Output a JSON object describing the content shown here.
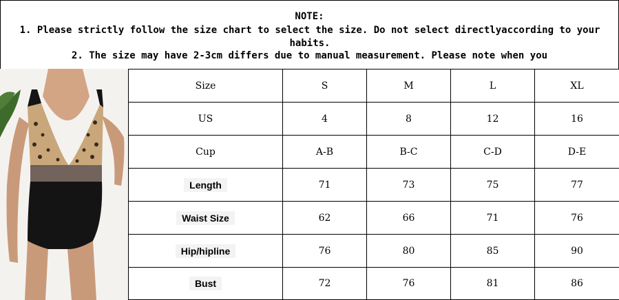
{
  "note": {
    "title": "NOTE:",
    "line1": "1. Please strictly follow the size chart to select the size. Do not select directlyaccording to your habits.",
    "line2": "2. The size may have 2-3cm differs due to manual measurement. Please note when you"
  },
  "table": {
    "header": {
      "label": "Size",
      "values": [
        "S",
        "M",
        "L",
        "XL"
      ]
    },
    "rows": [
      {
        "label": "US",
        "values": [
          "4",
          "8",
          "12",
          "16"
        ]
      },
      {
        "label": "Cup",
        "values": [
          "A-B",
          "B-C",
          "C-D",
          "D-E"
        ]
      },
      {
        "label": "Length",
        "values": [
          "71",
          "73",
          "75",
          "77"
        ]
      },
      {
        "label": "Waist Size",
        "values": [
          "62",
          "66",
          "71",
          "76"
        ]
      },
      {
        "label": "Hip/hipline",
        "values": [
          "76",
          "80",
          "85",
          "90"
        ]
      },
      {
        "label": "Bust",
        "values": [
          "72",
          "76",
          "81",
          "86"
        ]
      }
    ]
  },
  "colors": {
    "leopard_base": "#c9a77a",
    "leopard_spot": "#3a2a1c",
    "swimsuit": "#141414",
    "skin": "#c99a7a",
    "leaf": "#3d6b2c"
  }
}
